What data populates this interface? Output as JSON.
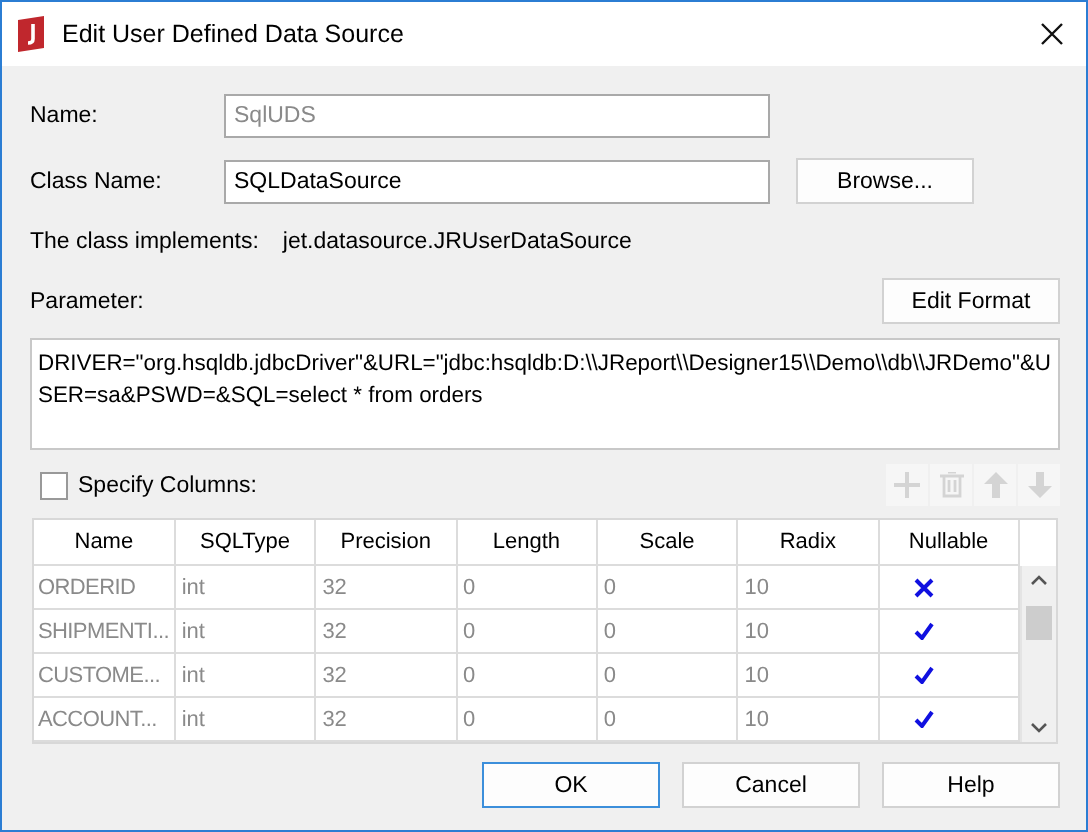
{
  "window": {
    "title": "Edit User Defined Data Source"
  },
  "name": {
    "label": "Name:",
    "value": "SqlUDS",
    "disabled": true
  },
  "class_name": {
    "label": "Class Name:",
    "value": "SQLDataSource",
    "button": "Browse..."
  },
  "implements": {
    "label": "The class implements:",
    "value": "jet.datasource.JRUserDataSource"
  },
  "parameter": {
    "label": "Parameter:",
    "button": "Edit Format",
    "value": "DRIVER=\"org.hsqldb.jdbcDriver\"&URL=\"jdbc:hsqldb:D:\\\\JReport\\\\Designer15\\\\Demo\\\\db\\\\JRDemo\"&USER=sa&PSWD=&SQL=select * from orders"
  },
  "specify_columns": {
    "label": "Specify Columns:",
    "checked": false
  },
  "table": {
    "disabled": true,
    "columns": [
      "Name",
      "SQLType",
      "Precision",
      "Length",
      "Scale",
      "Radix",
      "Nullable"
    ],
    "rows": [
      {
        "cells": [
          "ORDERID",
          "int",
          "32",
          "0",
          "0",
          "10"
        ],
        "nullable": false
      },
      {
        "cells": [
          "SHIPMENTI...",
          "int",
          "32",
          "0",
          "0",
          "10"
        ],
        "nullable": true
      },
      {
        "cells": [
          "CUSTOME...",
          "int",
          "32",
          "0",
          "0",
          "10"
        ],
        "nullable": true
      },
      {
        "cells": [
          "ACCOUNT...",
          "int",
          "32",
          "0",
          "0",
          "10"
        ],
        "nullable": true
      }
    ]
  },
  "buttons": [
    {
      "label": "OK",
      "default": true
    },
    {
      "label": "Cancel",
      "default": false
    },
    {
      "label": "Help",
      "default": false
    }
  ]
}
